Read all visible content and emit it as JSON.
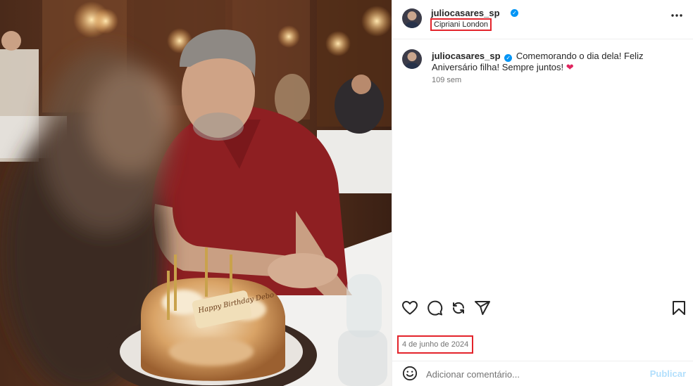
{
  "post": {
    "username": "juliocasares_sp",
    "location": "Cipriani London",
    "caption": "Comemorando o dia dela! Feliz Aniversário filha! Sempre juntos! ",
    "caption_emoji": "❤",
    "time_ago": "109 sem",
    "date": "4 de junho de 2024",
    "cake_text": "Happy Birthday Debo"
  },
  "comment": {
    "placeholder": "Adicionar comentário...",
    "publish_label": "Publicar"
  },
  "icons": {
    "more": "more-options-icon",
    "like": "heart-icon",
    "comment": "comment-icon",
    "share": "repost-icon",
    "send": "send-icon",
    "save": "bookmark-icon",
    "emoji": "emoji-icon"
  },
  "colors": {
    "highlight_box": "#e3242b",
    "verified": "#0095f6",
    "publish_disabled": "#b2dffc",
    "muted_text": "#737373"
  }
}
